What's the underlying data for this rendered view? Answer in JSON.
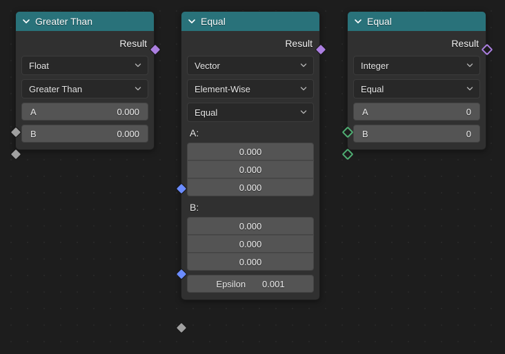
{
  "nodes": {
    "n0": {
      "title": "Greater Than",
      "result_label": "Result",
      "type_select": "Float",
      "op_select": "Greater Than",
      "inputs": [
        {
          "label": "A",
          "value": "0.000"
        },
        {
          "label": "B",
          "value": "0.000"
        }
      ]
    },
    "n1": {
      "title": "Equal",
      "result_label": "Result",
      "type_select": "Vector",
      "mode_select": "Element-Wise",
      "op_select": "Equal",
      "vecA_label": "A:",
      "vecA": [
        "0.000",
        "0.000",
        "0.000"
      ],
      "vecB_label": "B:",
      "vecB": [
        "0.000",
        "0.000",
        "0.000"
      ],
      "epsilon_label": "Epsilon",
      "epsilon_value": "0.001"
    },
    "n2": {
      "title": "Equal",
      "result_label": "Result",
      "type_select": "Integer",
      "op_select": "Equal",
      "inputs": [
        {
          "label": "A",
          "value": "0"
        },
        {
          "label": "B",
          "value": "0"
        }
      ]
    }
  }
}
